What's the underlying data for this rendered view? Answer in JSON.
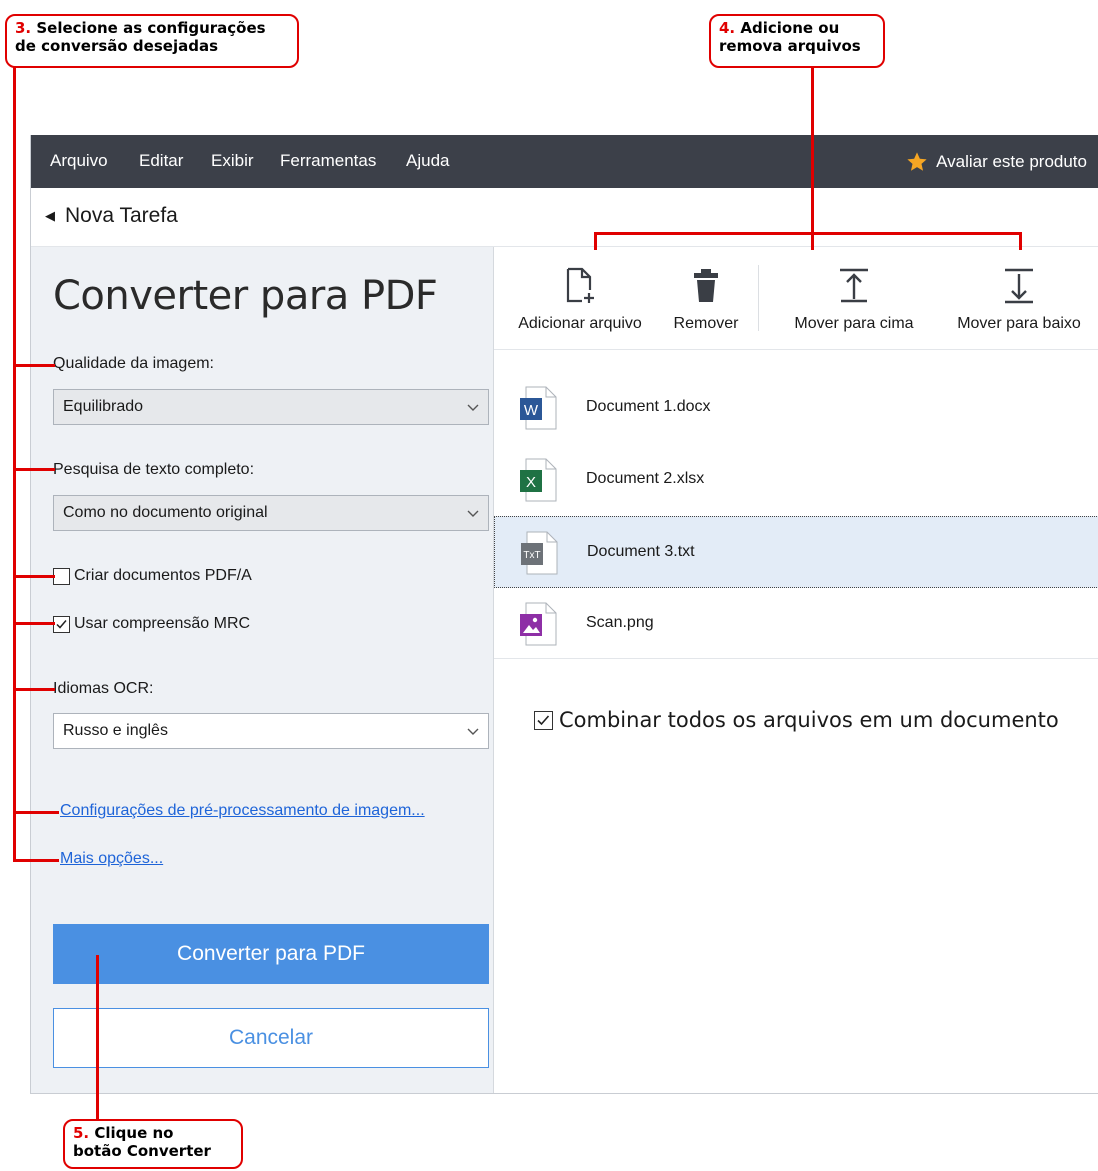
{
  "callouts": {
    "c3": {
      "num": "3.",
      "text1": " Selecione as configurações",
      "text2": "de conversão desejadas"
    },
    "c4": {
      "num": "4.",
      "text1": " Adicione ou",
      "text2": "remova arquivos"
    },
    "c5": {
      "num": "5.",
      "text1": " Clique no",
      "text2": "botão Converter"
    }
  },
  "menu": [
    "Arquivo",
    "Editar",
    "Exibir",
    "Ferramentas",
    "Ajuda"
  ],
  "rate_label": "Avaliar este produto",
  "nav": {
    "back_label": "Nova Tarefa"
  },
  "panel": {
    "title": "Converter para PDF",
    "quality_label": "Qualidade da imagem:",
    "quality_value": "Equilibrado",
    "search_label": "Pesquisa de texto completo:",
    "search_value": "Como no documento original",
    "pdfa_label": "Criar documentos PDF/A",
    "pdfa_checked": false,
    "mrc_label": "Usar compreensão MRC",
    "mrc_checked": true,
    "ocr_label": "Idiomas OCR:",
    "ocr_value": "Russo e inglês",
    "preproc_link": "Configurações de pré-processamento de imagem...",
    "more_link": "Mais opções...",
    "convert_button": "Converter para PDF",
    "cancel_button": "Cancelar"
  },
  "toolbar": {
    "add": "Adicionar arquivo",
    "remove": "Remover",
    "up": "Mover para cima",
    "down": "Mover para baixo"
  },
  "files": [
    {
      "name": "Document 1.docx",
      "icon": "word-file-icon",
      "badge": "W",
      "color": "#2b5797"
    },
    {
      "name": "Document 2.xlsx",
      "icon": "excel-file-icon",
      "badge": "X",
      "color": "#1f7244"
    },
    {
      "name": "Document 3.txt",
      "icon": "text-file-icon",
      "badge": "TxT",
      "color": "#6d7278",
      "selected": true
    },
    {
      "name": "Scan.png",
      "icon": "image-file-icon",
      "badge": "",
      "color": "#8e2fa6"
    }
  ],
  "combine_label": "Combinar todos os arquivos em um documento",
  "combine_checked": true,
  "colors": {
    "accent": "#4a90e2",
    "callout": "#e00000",
    "menubar": "#3c4049",
    "panel": "#eef1f5"
  }
}
